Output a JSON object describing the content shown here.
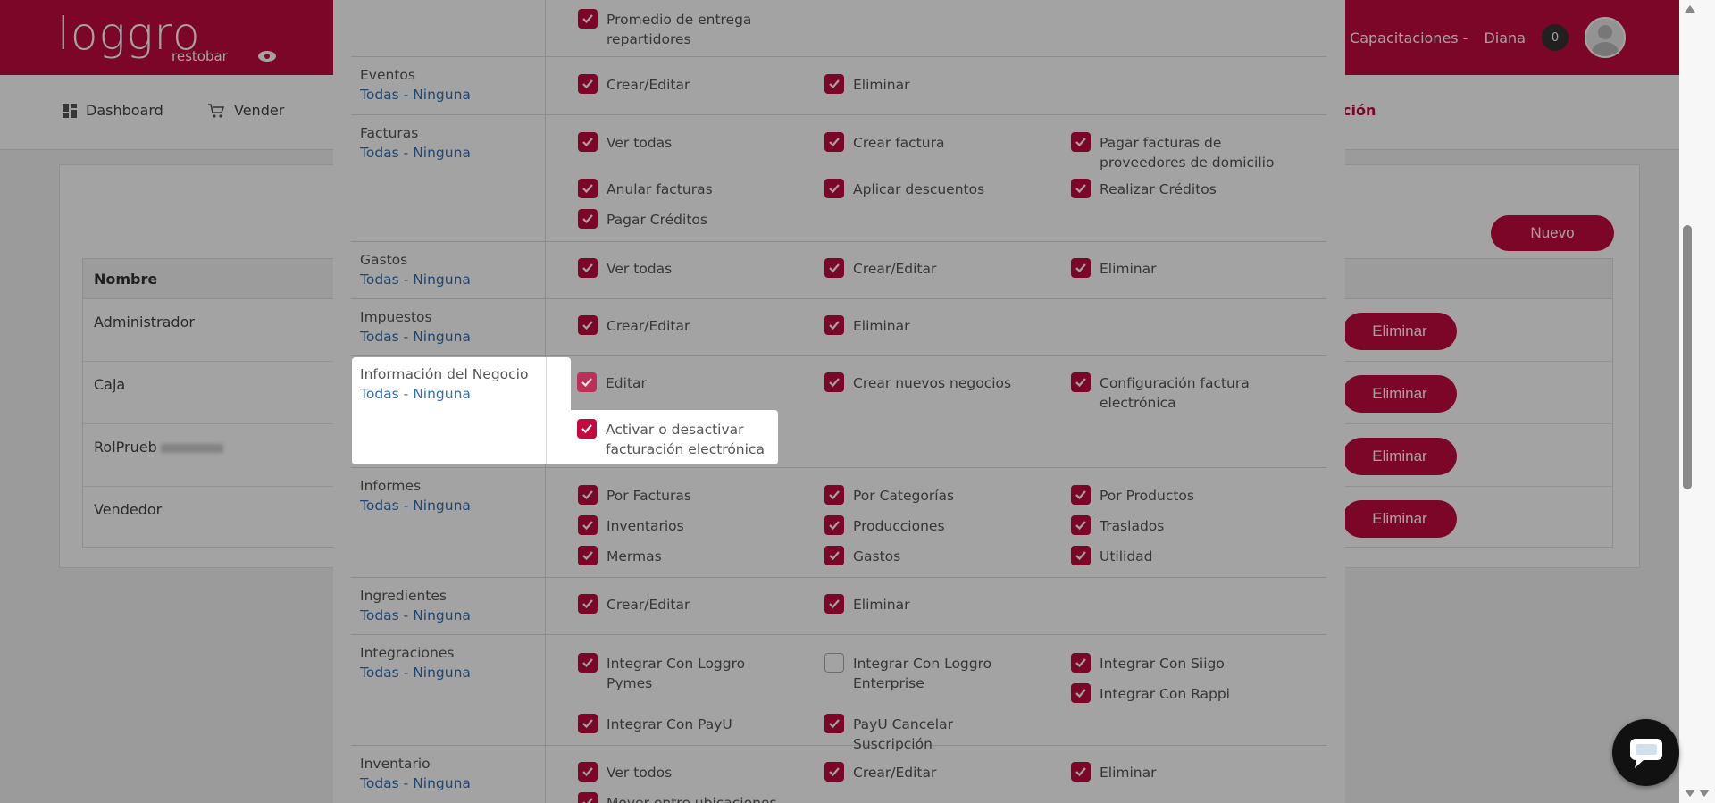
{
  "header": {
    "logo_text": "loggro",
    "logo_sub": "restobar",
    "company": "Capacitaciones -",
    "user": "Diana",
    "notifications": "0"
  },
  "nav": {
    "dashboard": "Dashboard",
    "vender": "Vender",
    "right_partial": "oción"
  },
  "roles": {
    "nuevo": "Nuevo",
    "header": "Nombre",
    "delete_label": "Eliminar",
    "rows": [
      "Administrador",
      "Caja",
      "RolPrueb",
      "Vendedor"
    ]
  },
  "modal": {
    "select_all": "Todas",
    "separator": " - ",
    "select_none": "Ninguna",
    "top_partial_item": "Promedio de entrega repartidores",
    "sections": {
      "eventos": {
        "name": "Eventos",
        "items": [
          "Crear/Editar",
          "Eliminar"
        ]
      },
      "facturas": {
        "name": "Facturas",
        "items": [
          "Ver todas",
          "Crear factura",
          "Pagar facturas de proveedores de domicilio",
          "Anular facturas",
          "Aplicar descuentos",
          "Realizar Créditos",
          "Pagar Créditos"
        ]
      },
      "gastos": {
        "name": "Gastos",
        "items": [
          "Ver todas",
          "Crear/Editar",
          "Eliminar"
        ]
      },
      "impuestos": {
        "name": "Impuestos",
        "items": [
          "Crear/Editar",
          "Eliminar"
        ]
      },
      "negocio": {
        "name": "Información del Negocio",
        "items": [
          "Editar",
          "Crear nuevos negocios",
          "Configuración factura electrónica",
          "Activar o desactivar facturación electrónica"
        ]
      },
      "informes": {
        "name": "Informes",
        "items": [
          "Por Facturas",
          "Por Categorías",
          "Por Productos",
          "Inventarios",
          "Producciones",
          "Traslados",
          "Mermas",
          "Gastos",
          "Utilidad"
        ]
      },
      "ingredientes": {
        "name": "Ingredientes",
        "items": [
          "Crear/Editar",
          "Eliminar"
        ]
      },
      "integraciones": {
        "name": "Integraciones",
        "items": [
          "Integrar Con Loggro Pymes",
          "Integrar Con Loggro Enterprise",
          "Integrar Con Siigo",
          "Integrar Con Rappi",
          "Integrar Con PayU",
          "PayU Cancelar Suscripción"
        ]
      },
      "inventario": {
        "name": "Inventario",
        "items": [
          "Ver todos",
          "Crear/Editar",
          "Eliminar",
          "Mover entre ubicaciones"
        ]
      }
    }
  },
  "colors": {
    "brand": "#c20a3e",
    "link": "#2f6fb3"
  }
}
